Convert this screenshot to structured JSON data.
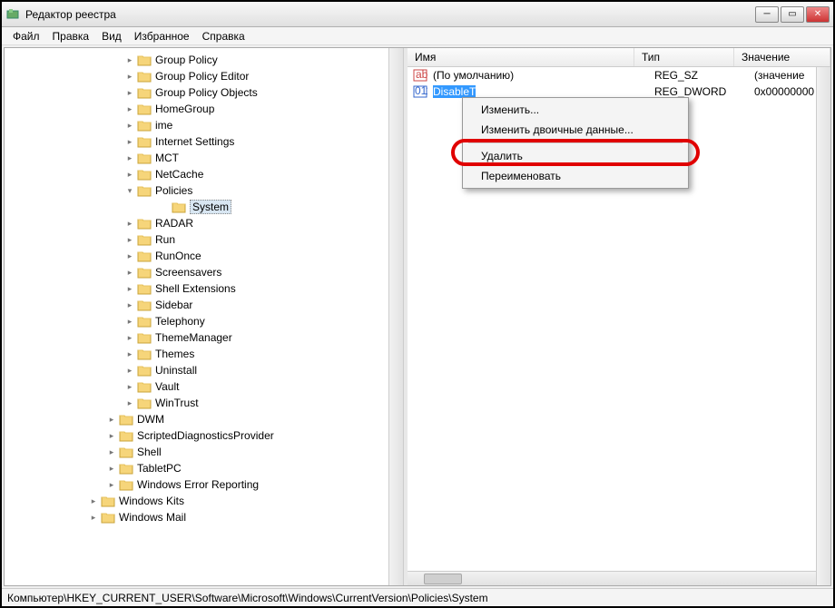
{
  "window": {
    "title": "Редактор реестра"
  },
  "menu": {
    "file": "Файл",
    "edit": "Правка",
    "view": "Вид",
    "favorites": "Избранное",
    "help": "Справка"
  },
  "columns": {
    "name": "Имя",
    "type": "Тип",
    "data": "Значение"
  },
  "values": [
    {
      "name": "(По умолчанию)",
      "type": "REG_SZ",
      "data": "(значение",
      "icon": "sz"
    },
    {
      "name": "DisableTaskMgr",
      "type": "REG_DWORD",
      "data": "0x00000000",
      "icon": "dword",
      "selected": true,
      "name_visible": "DisableT"
    }
  ],
  "context_menu": {
    "modify": "Изменить...",
    "modify_binary": "Изменить двоичные данные...",
    "delete": "Удалить",
    "rename": "Переименовать"
  },
  "tree": {
    "selected": "System",
    "items_level1": [
      "Group Policy",
      "Group Policy Editor",
      "Group Policy Objects",
      "HomeGroup",
      "ime",
      "Internet Settings",
      "MCT",
      "NetCache"
    ],
    "policies": "Policies",
    "policies_children": [
      "System"
    ],
    "items_after_policies": [
      "RADAR",
      "Run",
      "RunOnce",
      "Screensavers",
      "Shell Extensions",
      "Sidebar",
      "Telephony",
      "ThemeManager",
      "Themes",
      "Uninstall",
      "Vault",
      "WinTrust"
    ],
    "items_level0_after": [
      "DWM",
      "ScriptedDiagnosticsProvider",
      "Shell",
      "TabletPC",
      "Windows Error Reporting"
    ],
    "items_root_after": [
      "Windows Kits",
      "Windows Mail"
    ]
  },
  "statusbar": "Компьютер\\HKEY_CURRENT_USER\\Software\\Microsoft\\Windows\\CurrentVersion\\Policies\\System"
}
